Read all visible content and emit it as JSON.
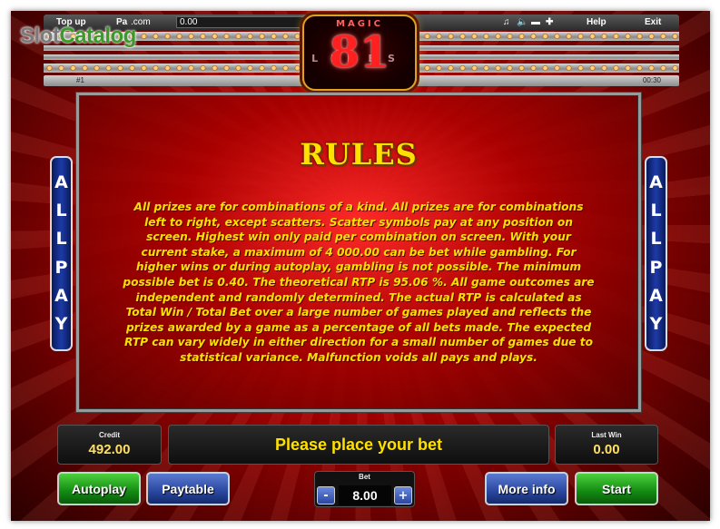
{
  "watermark": {
    "part1": "Slot",
    "part2": "Catalog"
  },
  "topbar": {
    "topup": "Top up",
    "paytable_short": "Pa",
    "com": ".com",
    "value": "0.00",
    "help": "Help",
    "exit": "Exit"
  },
  "infostrip": {
    "left": "#1",
    "right": "00:30"
  },
  "logo": {
    "magic": "MAGIC",
    "number": "81",
    "lines": "LINES"
  },
  "rules": {
    "title": "RULES",
    "text": "All prizes are for combinations of a kind. All prizes are for combinations left to right, except scatters. Scatter symbols pay at any position on screen. Highest win only paid per combination on screen. With your current stake, a maximum of 4 000.00 can be bet while gambling. For higher wins or during autoplay, gambling is not possible. The minimum possible bet is 0.40. The theoretical RTP is 95.06 %. All game outcomes are independent and randomly determined. The actual RTP is calculated as Total Win / Total Bet over a large number of games played and reflects the prizes awarded by a game as a percentage of all bets made. The expected RTP can vary widely in either direction for a small number of games due to statistical variance. Malfunction voids all pays and plays."
  },
  "side_banner": {
    "letters": [
      "A",
      "L",
      "L",
      "P",
      "A",
      "Y"
    ]
  },
  "display": {
    "credit_label": "Credit",
    "credit_value": "492.00",
    "message": "Please place your bet",
    "lastwin_label": "Last Win",
    "lastwin_value": "0.00"
  },
  "buttons": {
    "autoplay": "Autoplay",
    "paytable": "Paytable",
    "moreinfo": "More info",
    "start": "Start"
  },
  "bet": {
    "label": "Bet",
    "value": "8.00",
    "minus": "-",
    "plus": "+"
  },
  "colors": {
    "rules_text": "#ffe000",
    "background_red": "#c00000",
    "button_green": "#128a12",
    "button_blue": "#2a46a0"
  },
  "icons": [
    "music-icon",
    "speaker-icon",
    "screen-icon",
    "fullscreen-icon"
  ]
}
